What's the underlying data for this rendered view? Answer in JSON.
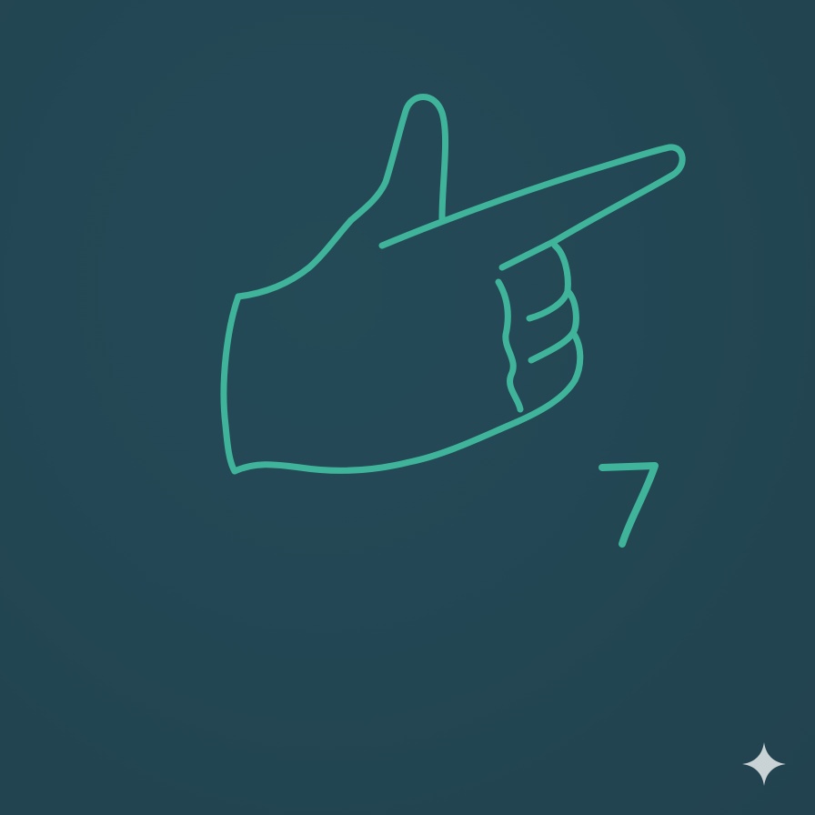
{
  "illustration": {
    "subject": "pointing-hand-icon",
    "number_label": "7"
  },
  "colors": {
    "background": "#234653",
    "stroke": "#3fb49a",
    "sparkle": "#c9d3d6"
  },
  "icons": {
    "hand": "pointing-hand-icon",
    "sparkle": "sparkle-icon"
  }
}
